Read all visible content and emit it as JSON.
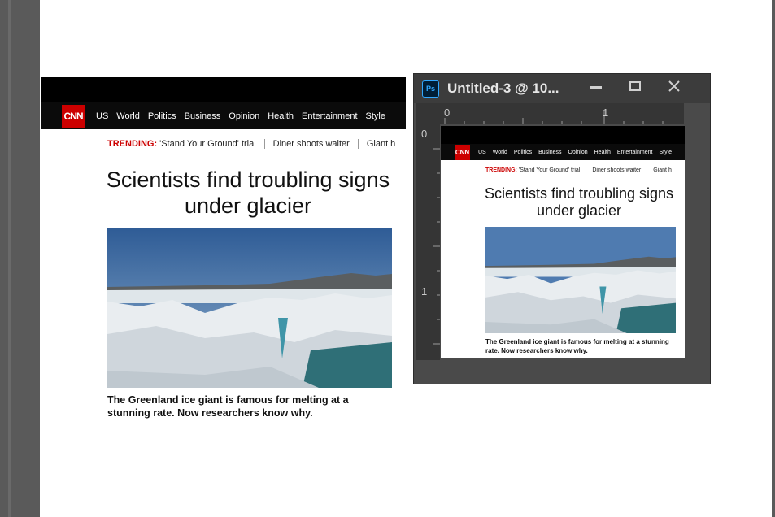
{
  "cnn": {
    "logo": "CNN",
    "nav": [
      "US",
      "World",
      "Politics",
      "Business",
      "Opinion",
      "Health",
      "Entertainment",
      "Style"
    ],
    "trending_label": "TRENDING:",
    "trending": [
      "'Stand Your Ground' trial",
      "Diner shoots waiter",
      "Giant h"
    ],
    "headline": "Scientists find troubling signs under glacier",
    "caption": "The Greenland ice giant is famous for melting at a stunning rate. Now researchers know why."
  },
  "photoshop": {
    "app_icon": "Ps",
    "title": "Untitled-3 @ 10...",
    "ruler_top": [
      "0",
      "1"
    ],
    "ruler_left": [
      "0",
      "1"
    ]
  },
  "colors": {
    "cnn_red": "#cc0000",
    "ps_blue": "#31a8ff",
    "ps_bg": "#4a4a4a"
  }
}
